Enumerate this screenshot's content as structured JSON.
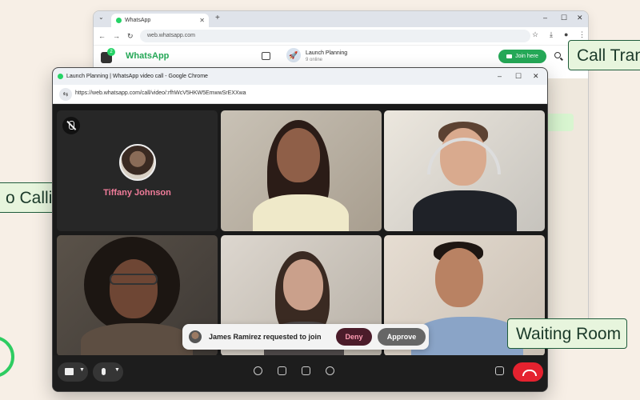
{
  "back_browser": {
    "tab_title": "WhatsApp",
    "url": "web.whatsapp.com",
    "app_title": "WhatsApp",
    "unread_badge": "2",
    "chat_name": "Launch Planning",
    "chat_status": "9 online",
    "join_label": "Join here"
  },
  "front_browser": {
    "window_title": "Launch Planning | WhatsApp video call - Google Chrome",
    "url": "https://web.whatsapp.com/call/video/:rfhWcV5HKW5EmwwSrEXXwa"
  },
  "participants": [
    {
      "name": "Tiffany Johnson",
      "muted": true
    },
    {
      "name": ""
    },
    {
      "name": ""
    },
    {
      "name": ""
    },
    {
      "name": ""
    },
    {
      "name": ""
    }
  ],
  "join_request": {
    "text": "James Ramirez requested to join",
    "deny_label": "Deny",
    "approve_label": "Approve"
  },
  "pills": {
    "left": "o Calling",
    "right_top": "Call Tran",
    "right_bottom": "Waiting Room"
  },
  "colors": {
    "accent": "#25a857",
    "end_call": "#e5222f",
    "deny": "#4b1c2a",
    "name_pink": "#f07c9a"
  }
}
